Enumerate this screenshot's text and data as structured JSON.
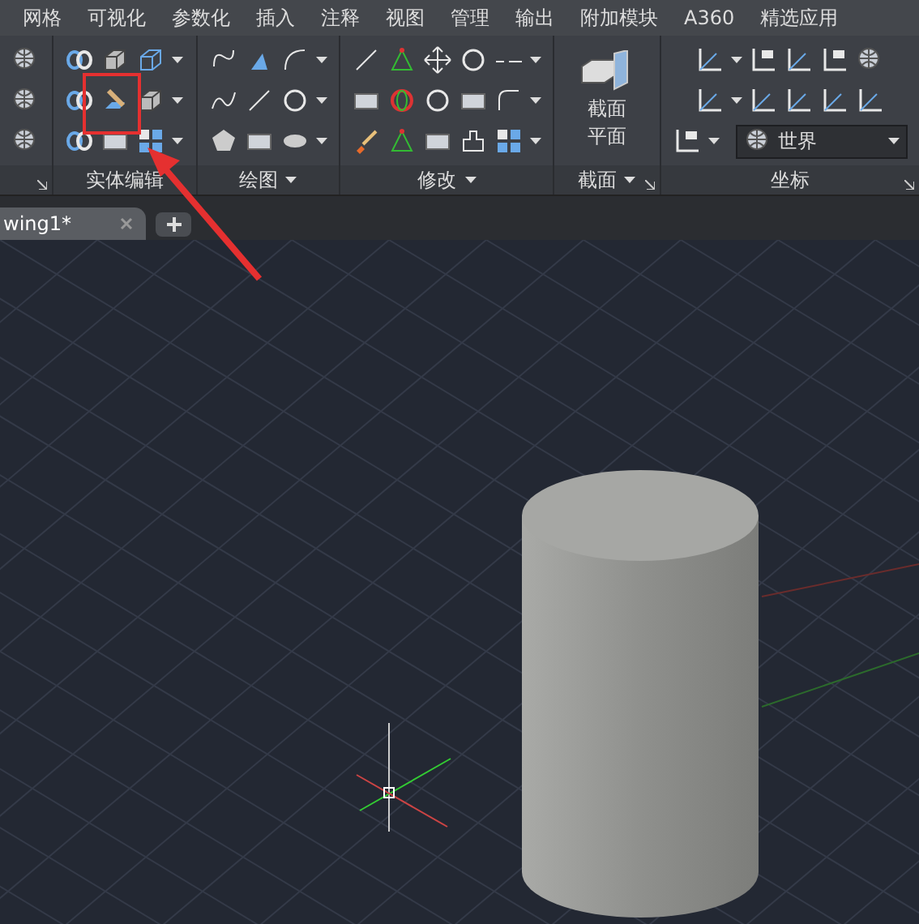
{
  "menu_tabs": [
    {
      "label": "网格",
      "selected": false
    },
    {
      "label": "可视化",
      "selected": false
    },
    {
      "label": "参数化",
      "selected": false
    },
    {
      "label": "插入",
      "selected": false
    },
    {
      "label": "注释",
      "selected": false
    },
    {
      "label": "视图",
      "selected": false
    },
    {
      "label": "管理",
      "selected": false
    },
    {
      "label": "输出",
      "selected": false
    },
    {
      "label": "附加模块",
      "selected": false
    },
    {
      "label": "A360",
      "selected": false
    },
    {
      "label": "精选应用",
      "selected": false
    }
  ],
  "panels": [
    {
      "kind": "icons",
      "launcher": true,
      "menu": false
    },
    {
      "kind": "icons",
      "title": "实体编辑",
      "launcher": false,
      "menu": false
    },
    {
      "kind": "icons",
      "title": "绘图",
      "launcher": false,
      "menu": true
    },
    {
      "kind": "icons",
      "title": "修改",
      "launcher": false,
      "menu": true
    },
    {
      "kind": "section",
      "title": "截面",
      "launcher": true,
      "menu": true,
      "button_label": "截面平面"
    },
    {
      "kind": "coordinates",
      "title": "坐标",
      "launcher": true,
      "menu": false,
      "combo_value": "世界"
    }
  ],
  "file_tabs": [
    {
      "label": "wing1*",
      "selected": true
    }
  ]
}
